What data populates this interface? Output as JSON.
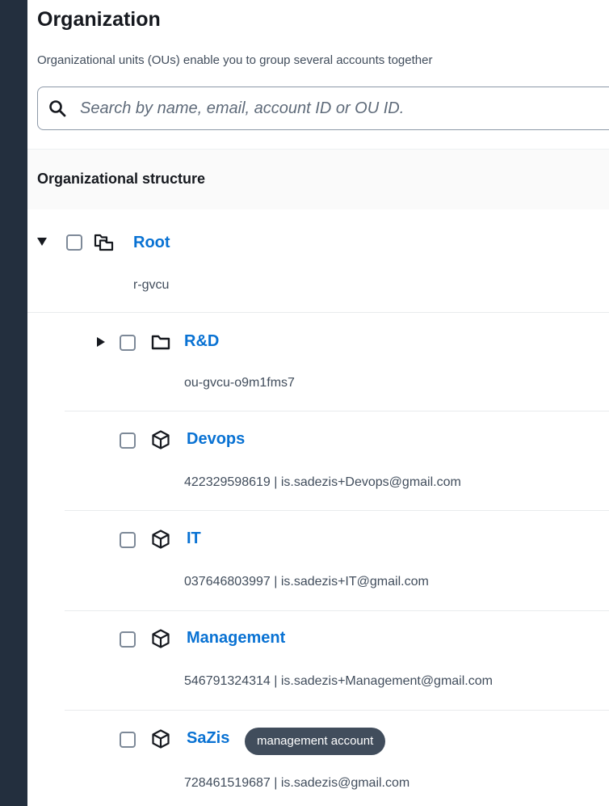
{
  "header": {
    "title": "Organization",
    "description": "Organizational units (OUs) enable you to group several accounts together"
  },
  "search": {
    "placeholder": "Search by name, email, account ID or OU ID."
  },
  "structure": {
    "title": "Organizational structure",
    "root": {
      "name": "Root",
      "id": "r-gvcu"
    },
    "ou": {
      "name": "R&D",
      "id": "ou-gvcu-o9m1fms7"
    },
    "accounts": [
      {
        "name": "Devops",
        "details": "422329598619  |  is.sadezis+Devops@gmail.com"
      },
      {
        "name": "IT",
        "details": "037646803997  |  is.sadezis+IT@gmail.com"
      },
      {
        "name": "Management",
        "details": "546791324314  |  is.sadezis+Management@gmail.com"
      },
      {
        "name": "SaZis",
        "details": "728461519687  |  is.sadezis@gmail.com",
        "badge": "management account"
      }
    ]
  },
  "colors": {
    "link": "#0972d3",
    "badge_bg": "#414d5c",
    "page_bg": "#232f3e"
  }
}
